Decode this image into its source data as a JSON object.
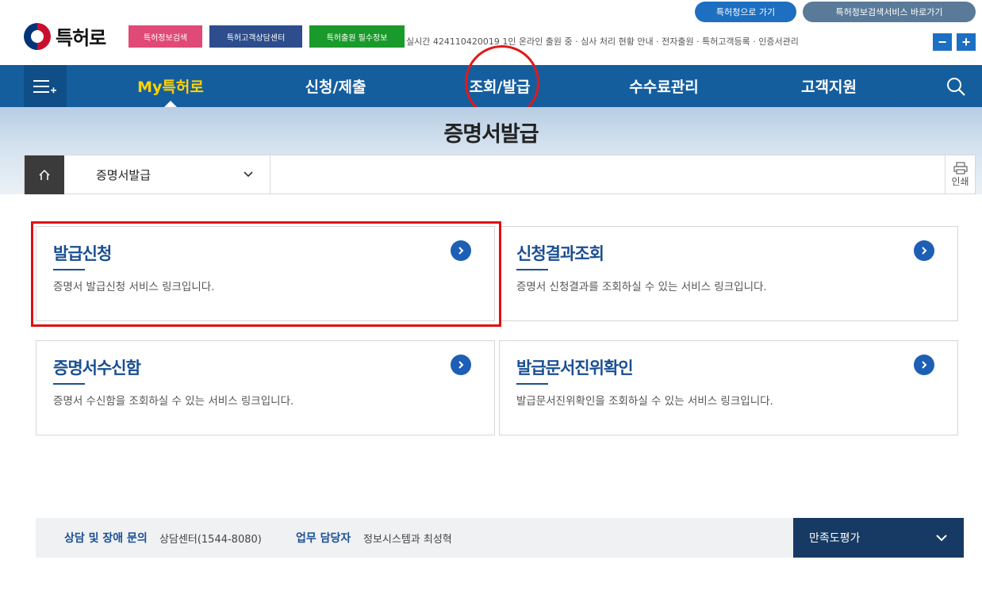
{
  "header": {
    "logo_text": "특허로",
    "banners": [
      "특허정보검색",
      "특허고객상담센터",
      "특허출원 필수정보"
    ],
    "ticker": "실시간 424110420019 1인 온라인 출원 중 · 심사 처리 현황 안내 · 전자출원 · 특허고객등록 · 인증서관리",
    "pill_links": [
      "특허청으로 가기",
      "특허정보검색서비스 바로가기"
    ],
    "zoom_out": "−",
    "zoom_in": "+"
  },
  "nav": {
    "menu_icon": "hamburger-plus-icon",
    "items": [
      {
        "label": "My특허로",
        "active": true
      },
      {
        "label": "신청/제출",
        "active": false
      },
      {
        "label": "조회/발급",
        "active": false
      },
      {
        "label": "수수료관리",
        "active": false
      },
      {
        "label": "고객지원",
        "active": false
      }
    ],
    "search_icon": "search-icon"
  },
  "page": {
    "title": "증명서발급",
    "breadcrumb_select": "증명서발급",
    "print_label": "인쇄"
  },
  "cards": [
    {
      "title": "발급신청",
      "desc": "증명서 발급신청 서비스 링크입니다."
    },
    {
      "title": "신청결과조회",
      "desc": "증명서 신청결과를 조회하실 수 있는 서비스 링크입니다."
    },
    {
      "title": "증명서수신함",
      "desc": "증명서 수신함을 조회하실 수 있는 서비스 링크입니다."
    },
    {
      "title": "발급문서진위확인",
      "desc": "발급문서진위확인을 조회하실 수 있는 서비스 링크입니다."
    }
  ],
  "footer": {
    "support_label": "상담 및 장애 문의",
    "support_value": "상담센터(1544-8080)",
    "manager_label": "업무 담당자",
    "manager_value": "정보시스템과 최성혁",
    "survey_label": "만족도평가"
  },
  "colors": {
    "nav_bg": "#155e9e",
    "active_nav": "#ffd400",
    "card_title": "#1a4f91",
    "highlight_red": "#e01010",
    "footer_survey_bg": "#163a63"
  }
}
